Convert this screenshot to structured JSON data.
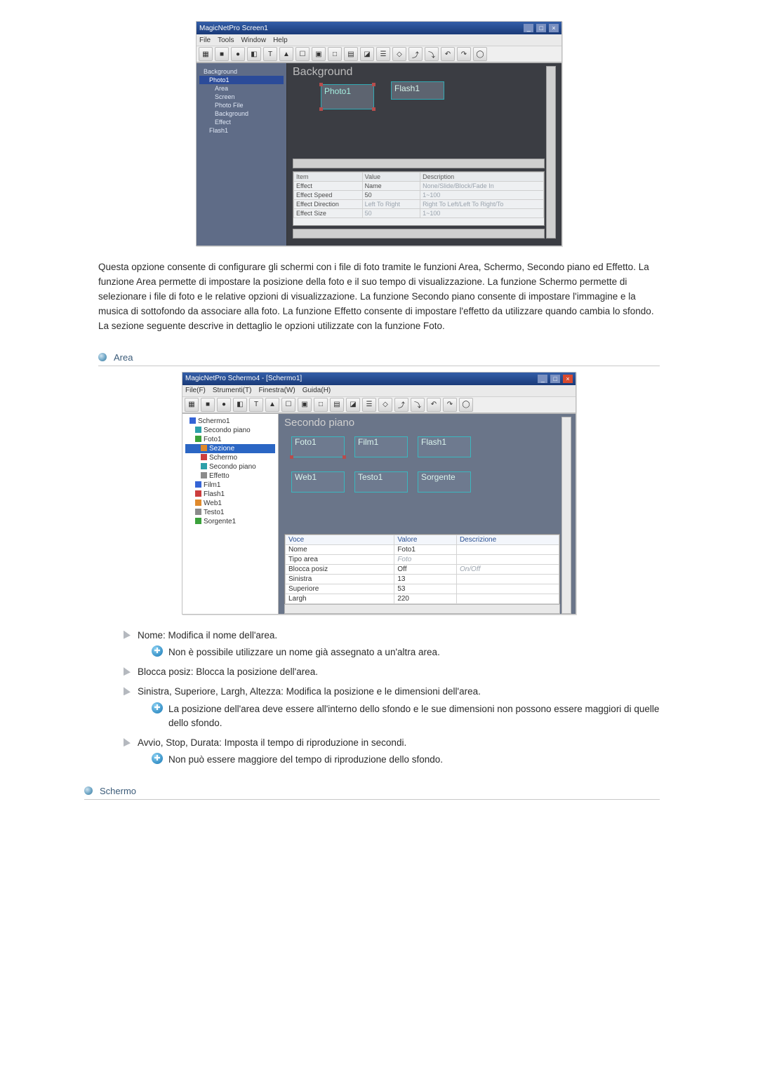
{
  "screenshotA": {
    "window_title": "MagicNetPro Screen1",
    "menus": [
      "File",
      "Tools",
      "Window",
      "Help"
    ],
    "tree": {
      "items": [
        "Background",
        "Photo1",
        "Area",
        "Screen",
        "Photo File",
        "Background",
        "Effect",
        "Flash1"
      ]
    },
    "canvas": {
      "bg_label": "Background",
      "box1": "Photo1",
      "box2": "Flash1"
    },
    "grid": {
      "headers": [
        "Item",
        "Value",
        "Description"
      ],
      "rows": [
        [
          "Effect",
          "Name",
          "None/Slide/Block/Fade In"
        ],
        [
          "Effect Speed",
          "50",
          "1~100"
        ],
        [
          "Effect Direction",
          "Left To Right",
          "Right To Left/Left To Right/To"
        ],
        [
          "Effect Size",
          "50",
          "1~100"
        ]
      ]
    }
  },
  "description": "Questa opzione consente di configurare gli schermi con i file di foto tramite le funzioni Area, Schermo, Secondo piano ed Effetto. La funzione Area permette di impostare la posizione della foto e il suo tempo di visualizzazione. La funzione Schermo permette di selezionare i file di foto e le relative opzioni di visualizzazione. La funzione Secondo piano consente di impostare l'immagine e la musica di sottofondo da associare alla foto. La funzione Effetto consente di impostare l'effetto da utilizzare quando cambia lo sfondo. La sezione seguente descrive in dettaglio le opzioni utilizzate con la funzione Foto.",
  "sectionA_title": "Area",
  "screenshotB": {
    "window_title": "MagicNetPro Schermo4 - [Schermo1]",
    "menus": [
      "File(F)",
      "Strumenti(T)",
      "Finestra(W)",
      "Guida(H)"
    ],
    "tree": {
      "items": [
        "Schermo1",
        "Secondo piano",
        "Foto1",
        "Sezione",
        "Schermo",
        "Secondo piano",
        "Effetto",
        "Film1",
        "Flash1",
        "Web1",
        "Testo1",
        "Sorgente1"
      ]
    },
    "canvas": {
      "bg_label": "Secondo piano",
      "box1": "Foto1",
      "box2": "Film1",
      "box3": "Flash1",
      "box4": "Web1",
      "box5": "Testo1",
      "box6": "Sorgente"
    },
    "grid": {
      "headers": [
        "Voce",
        "Valore",
        "Descrizione"
      ],
      "rows": [
        [
          "Nome",
          "Foto1",
          ""
        ],
        [
          "Tipo area",
          "Foto",
          ""
        ],
        [
          "Blocca posiz",
          "Off",
          "On/Off"
        ],
        [
          "Sinistra",
          "13",
          ""
        ],
        [
          "Superiore",
          "53",
          ""
        ],
        [
          "Largh",
          "220",
          ""
        ]
      ]
    }
  },
  "bullets": [
    {
      "text": "Nome: Modifica il nome dell'area.",
      "note": "Non è possibile utilizzare un nome già assegnato a un'altra area."
    },
    {
      "text": "Blocca posiz: Blocca la posizione dell'area."
    },
    {
      "text": "Sinistra, Superiore, Largh, Altezza: Modifica la posizione e le dimensioni dell'area.",
      "note": "La posizione dell'area deve essere all'interno dello sfondo e le sue dimensioni non possono essere maggiori di quelle dello sfondo."
    },
    {
      "text": "Avvio, Stop, Durata: Imposta il tempo di riproduzione in secondi.",
      "note": "Non può essere maggiore del tempo di riproduzione dello sfondo."
    }
  ],
  "sectionB_title": "Schermo",
  "toolbar_icons": [
    "▦",
    "■",
    "●",
    "◧",
    "T",
    "▲",
    "☐",
    "▣",
    "□",
    "▤",
    "◪",
    "☰",
    "◇",
    "⤴",
    "⤵",
    "↶",
    "↷",
    "◯"
  ]
}
